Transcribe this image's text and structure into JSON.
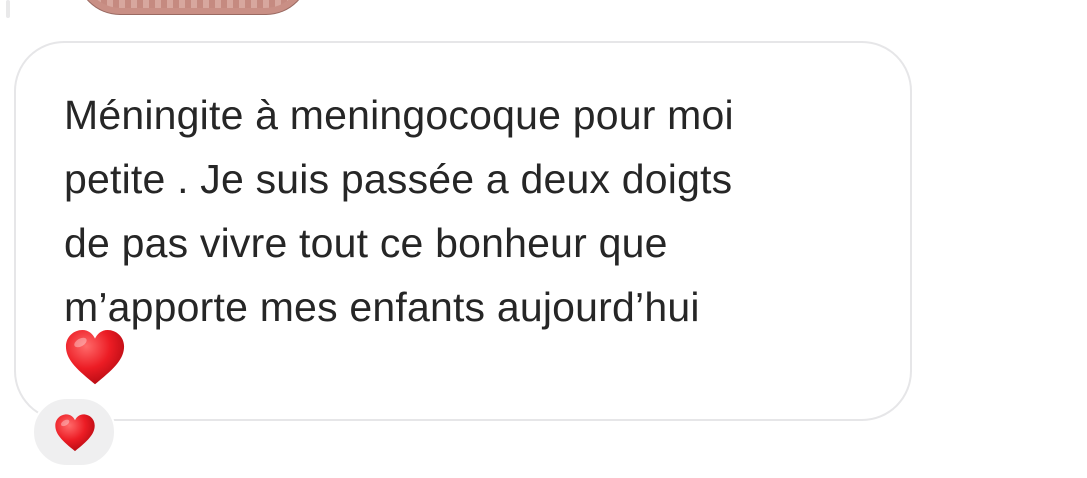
{
  "message": {
    "lines": [
      "Méningite à meningocoque pour moi",
      "petite . Je suis passée a deux doigts",
      "de pas vivre tout ce bonheur que",
      "m’apporte mes enfants aujourd’hui"
    ],
    "text": "Méningite à meningocoque pour moi\npetite . Je suis passée a deux doigts\nde pas vivre tout ce bonheur que\nm’apporte mes enfants aujourd’hui",
    "emoji_icon": "red-heart-icon"
  },
  "reaction": {
    "emoji_icon": "red-heart-icon"
  },
  "colors": {
    "text": "#262626",
    "bubble_border": "#e6e6e8",
    "reaction_bg": "#efeff0",
    "heart": "#e0141e"
  }
}
